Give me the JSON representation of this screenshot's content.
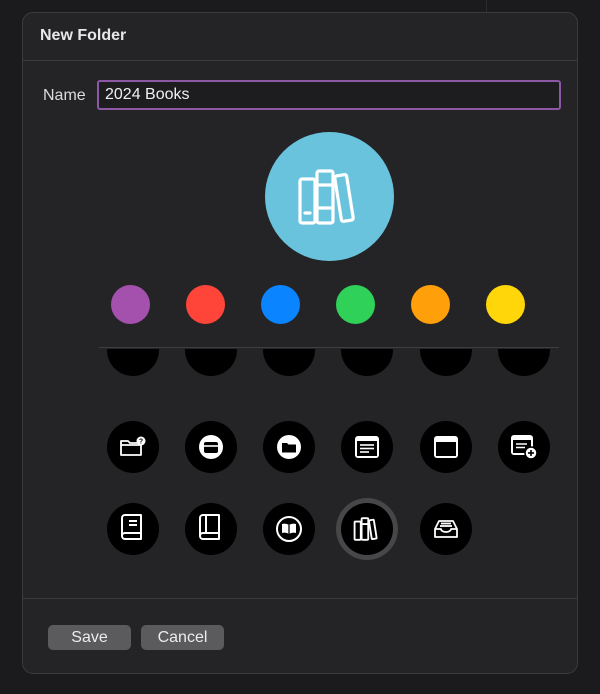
{
  "dialog": {
    "title": "New Folder",
    "name_label": "Name",
    "name_value": "2024 Books",
    "preview_icon": "books-icon",
    "preview_color": "#6ac3dd"
  },
  "colors": [
    {
      "name": "purple",
      "hex": "#a451ad"
    },
    {
      "name": "red",
      "hex": "#ff453a"
    },
    {
      "name": "blue",
      "hex": "#0a84ff"
    },
    {
      "name": "green",
      "hex": "#30d158"
    },
    {
      "name": "orange",
      "hex": "#ff9f0a"
    },
    {
      "name": "yellow",
      "hex": "#ffd60a"
    }
  ],
  "icons": {
    "row2": [
      "folder-question-icon",
      "archive-box-icon",
      "folder-icon",
      "note-icon",
      "window-icon",
      "note-add-icon"
    ],
    "row3": [
      "book-icon",
      "closed-book-icon",
      "open-book-icon",
      "books-icon",
      "tray-icon"
    ],
    "selected": "books-icon"
  },
  "buttons": {
    "save": "Save",
    "cancel": "Cancel"
  }
}
